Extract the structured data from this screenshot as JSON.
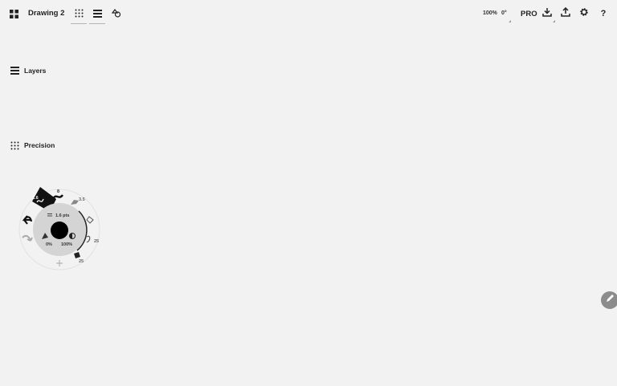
{
  "app": {
    "title": "Drawing 2",
    "pro_label": "PRO"
  },
  "toolbar": {
    "zoom": "100%",
    "rotation": "0°"
  },
  "panels": {
    "layers_label": "Layers",
    "precision_label": "Precision"
  },
  "brush_wheel": {
    "selected_size": "1.6",
    "size_mark_small": "8",
    "size_mark_large": "3.5",
    "size_readout": "1.6 pts",
    "opacity": "0%",
    "flow": "100%",
    "pressure_mark": "25",
    "size_mark_bottom": "25"
  },
  "colors": {
    "background": "#f3f2f3",
    "wheel_fill": "#d4d4d4",
    "brush_color": "#000000",
    "edge_button": "#8c8c8c"
  },
  "icons": [
    "apps-grid-icon",
    "grid-icon",
    "layers-icon",
    "shapes-icon",
    "import-icon",
    "export-icon",
    "gear-icon",
    "help-icon",
    "undo-icon",
    "redo-icon",
    "pencil-icon"
  ]
}
